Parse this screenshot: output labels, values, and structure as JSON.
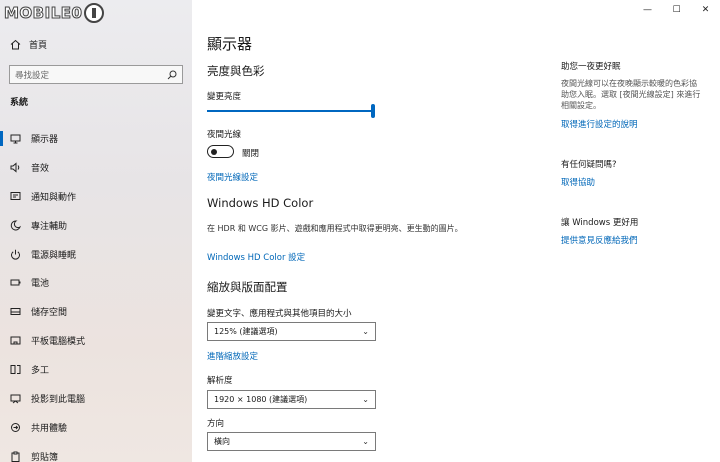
{
  "watermark": "MOBILE01",
  "sidebar": {
    "home_label": "首頁",
    "search_placeholder": "尋找設定",
    "section_label": "系統",
    "items": [
      {
        "label": "顯示器",
        "icon": "monitor-icon",
        "selected": true
      },
      {
        "label": "音效",
        "icon": "speaker-icon"
      },
      {
        "label": "通知與動作",
        "icon": "notification-icon"
      },
      {
        "label": "專注輔助",
        "icon": "moon-icon"
      },
      {
        "label": "電源與睡眠",
        "icon": "power-icon"
      },
      {
        "label": "電池",
        "icon": "battery-icon"
      },
      {
        "label": "儲存空間",
        "icon": "storage-icon"
      },
      {
        "label": "平板電腦模式",
        "icon": "tablet-icon"
      },
      {
        "label": "多工",
        "icon": "multitask-icon"
      },
      {
        "label": "投影到此電腦",
        "icon": "project-icon"
      },
      {
        "label": "共用體驗",
        "icon": "shared-icon"
      },
      {
        "label": "剪貼簿",
        "icon": "clipboard-icon"
      }
    ]
  },
  "window": {
    "minimize": "—",
    "maximize": "☐",
    "close": "✕"
  },
  "main": {
    "title": "顯示器",
    "brightness": {
      "heading": "亮度與色彩",
      "slider_label": "變更亮度",
      "slider_value": 1.0,
      "night_light_label": "夜間光線",
      "night_light_state": "關閉",
      "night_light_link": "夜間光線設定"
    },
    "hdr": {
      "heading": "Windows HD Color",
      "description": "在 HDR 和 WCG 影片、遊戲和應用程式中取得更明亮、更生動的圖片。",
      "link": "Windows HD Color 設定"
    },
    "scale": {
      "heading": "縮放與版面配置",
      "size_label": "變更文字、應用程式與其他項目的大小",
      "size_value": "125% (建議選項)",
      "advanced_link": "進階縮放設定",
      "resolution_label": "解析度",
      "resolution_value": "1920 × 1080 (建議選項)",
      "orientation_label": "方向",
      "orientation_value": "橫向"
    }
  },
  "right": {
    "sleep_title": "助您一夜更好眠",
    "sleep_text": "夜間光線可以在夜晚顯示較暖的色彩協助您入眠。選取 [夜間光線設定] 來進行相關設定。",
    "sleep_link": "取得進行設定的說明",
    "question_title": "有任何疑問嗎?",
    "question_link": "取得協助",
    "better_title": "讓 Windows 更好用",
    "better_link": "提供意見反應給我們"
  }
}
